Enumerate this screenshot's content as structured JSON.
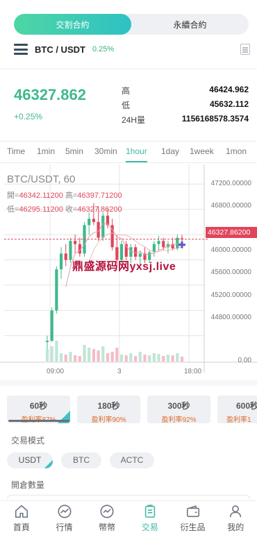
{
  "contract_tabs": [
    {
      "label": "交割合約",
      "active": true
    },
    {
      "label": "永續合約",
      "active": false
    }
  ],
  "pair": {
    "symbol": "BTC / USDT",
    "change": "0.25%"
  },
  "quote": {
    "price": "46327.862",
    "change": "+0.25%",
    "stats": [
      {
        "label": "高",
        "value": "46424.962"
      },
      {
        "label": "低",
        "value": "45632.112"
      },
      {
        "label": "24H量",
        "value": "1156168578.3574"
      }
    ]
  },
  "time_tabs": [
    {
      "label": "Time",
      "active": false
    },
    {
      "label": "1min",
      "active": false
    },
    {
      "label": "5min",
      "active": false
    },
    {
      "label": "30min",
      "active": false
    },
    {
      "label": "1hour",
      "active": true
    },
    {
      "label": "1day",
      "active": false
    },
    {
      "label": "1week",
      "active": false
    },
    {
      "label": "1mon",
      "active": false
    }
  ],
  "chart": {
    "title": "BTC/USDT, 60",
    "ohlc_line1": {
      "open_label": "開=",
      "open": "46342.11200",
      "high_label": "高=",
      "high": "46397.71200"
    },
    "ohlc_line2": {
      "low_label": "低=",
      "low": "46295.11200",
      "close_label": "收=",
      "close": "46327.86200"
    },
    "current_price": "46327.86200",
    "y_ticks": [
      "47200.00000",
      "46800.00000",
      "46400.00000",
      "46000.00000",
      "45600.00000",
      "45200.00000",
      "44800.00000",
      "0.00"
    ],
    "x_ticks": [
      "09:00",
      "3",
      "18:00"
    ],
    "watermark": "鼎盛源码网yxsj.live",
    "colors": {
      "up": "#3fb98a",
      "down": "#e0455b"
    }
  },
  "chart_data": {
    "type": "candlestick",
    "title": "BTC/USDT, 60",
    "y_range": [
      44600,
      47400
    ],
    "ohlc": [
      [
        44700,
        44800,
        44550,
        44720
      ],
      [
        44720,
        45250,
        44700,
        45200
      ],
      [
        45200,
        45900,
        45150,
        45850
      ],
      [
        45850,
        46200,
        45700,
        46100
      ],
      [
        46100,
        46250,
        45900,
        46000
      ],
      [
        46000,
        46350,
        45950,
        46300
      ],
      [
        46300,
        46400,
        46100,
        46250
      ],
      [
        46250,
        46350,
        46050,
        46100
      ],
      [
        46100,
        46600,
        46050,
        46550
      ],
      [
        46550,
        46750,
        46400,
        46650
      ],
      [
        46650,
        46900,
        46550,
        46600
      ],
      [
        46600,
        46850,
        46300,
        46350
      ],
      [
        46350,
        46750,
        46300,
        46700
      ],
      [
        46700,
        46800,
        46500,
        46550
      ],
      [
        46550,
        46650,
        46150,
        46200
      ],
      [
        46200,
        46400,
        45900,
        46000
      ],
      [
        46000,
        46300,
        45950,
        46250
      ],
      [
        46250,
        46300,
        46000,
        46050
      ],
      [
        46050,
        46250,
        45950,
        46200
      ],
      [
        46200,
        46250,
        46000,
        46050
      ],
      [
        46050,
        46150,
        45900,
        46100
      ],
      [
        46100,
        46200,
        45950,
        46000
      ],
      [
        46000,
        46150,
        45950,
        46120
      ],
      [
        46120,
        46300,
        46050,
        46250
      ],
      [
        46250,
        46380,
        46150,
        46300
      ],
      [
        46300,
        46350,
        46150,
        46200
      ],
      [
        46200,
        46300,
        46100,
        46250
      ],
      [
        46250,
        46350,
        46150,
        46180
      ],
      [
        46180,
        46400,
        46150,
        46350
      ],
      [
        46342,
        46397,
        46295,
        46327
      ]
    ],
    "volume": [
      18,
      22,
      30,
      12,
      10,
      14,
      9,
      8,
      24,
      20,
      18,
      16,
      22,
      12,
      14,
      20,
      10,
      9,
      12,
      8,
      14,
      10,
      9,
      12,
      11,
      8,
      10,
      9,
      12,
      7
    ]
  },
  "trade_cards": [
    {
      "title": "60秒",
      "rate": "盈利率87%",
      "selected": true
    },
    {
      "title": "180秒",
      "rate": "盈利率90%",
      "selected": false
    },
    {
      "title": "300秒",
      "rate": "盈利率92%",
      "selected": false
    },
    {
      "title": "600秒",
      "rate": "盈利率1",
      "selected": false
    }
  ],
  "trade_mode_label": "交易模式",
  "modes": [
    {
      "label": "USDT",
      "selected": true
    },
    {
      "label": "BTC",
      "selected": false
    },
    {
      "label": "ACTC",
      "selected": false
    }
  ],
  "open_qty_label": "開倉數量",
  "nav": [
    {
      "label": "首頁",
      "icon": "home-icon",
      "active": false
    },
    {
      "label": "行情",
      "icon": "market-icon",
      "active": false
    },
    {
      "label": "幣幣",
      "icon": "coin-exchange-icon",
      "active": false
    },
    {
      "label": "交易",
      "icon": "trade-icon",
      "active": true
    },
    {
      "label": "衍生品",
      "icon": "wallet-icon",
      "active": false
    },
    {
      "label": "我的",
      "icon": "user-icon",
      "active": false
    }
  ]
}
